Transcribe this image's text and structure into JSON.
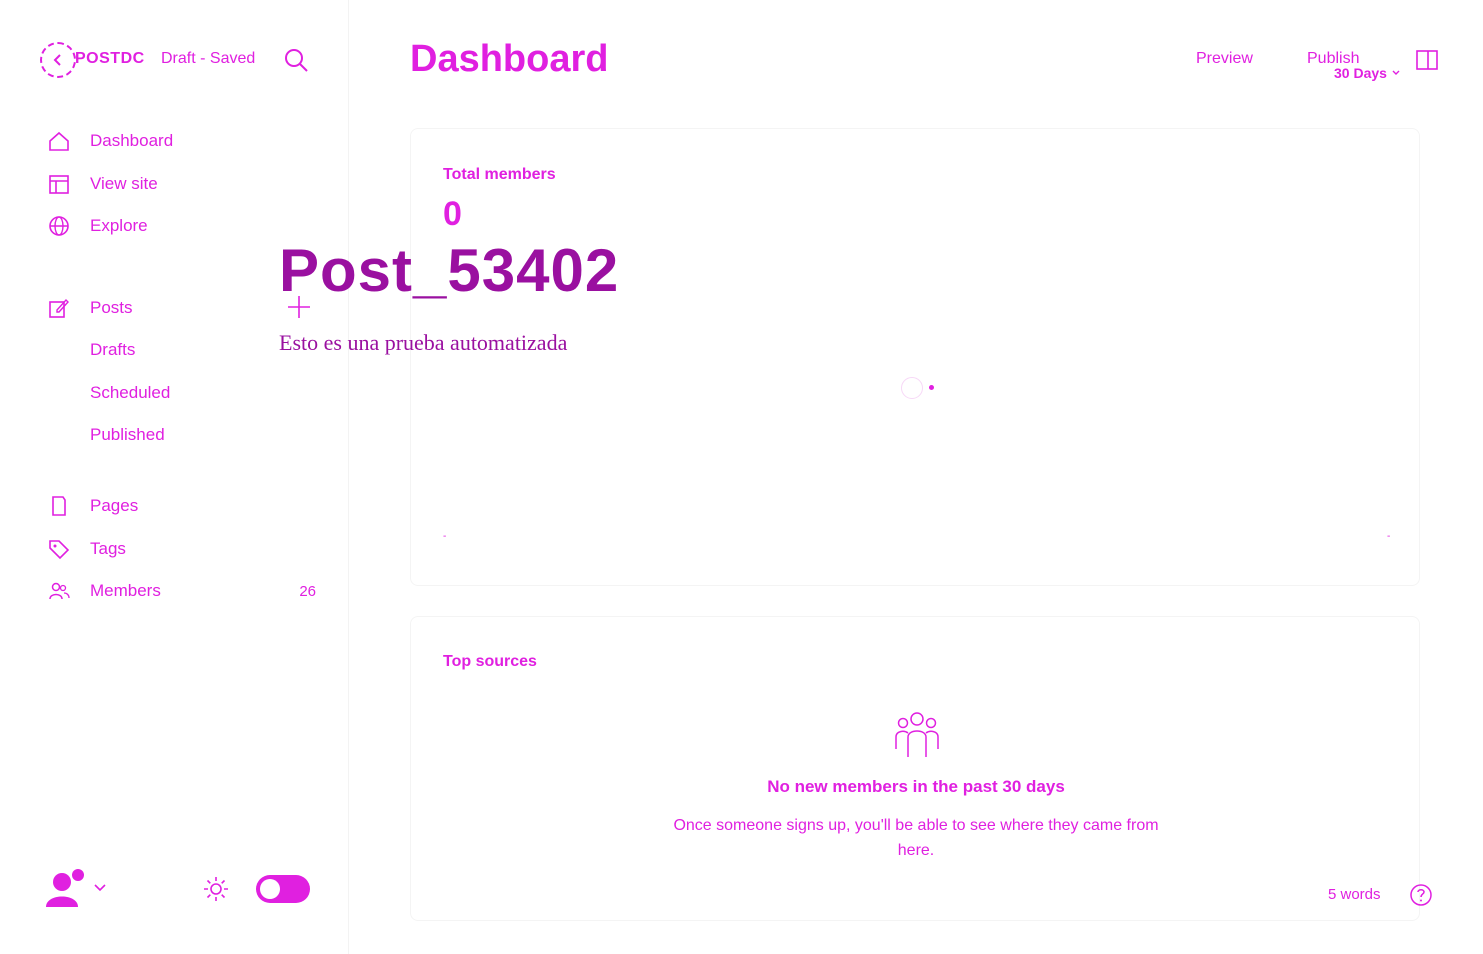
{
  "header": {
    "site_name": "POSTDC",
    "draft_status": "Draft - Saved",
    "page_title": "Dashboard",
    "preview_label": "Preview",
    "publish_label": "Publish",
    "range_label": "30 Days"
  },
  "sidebar": {
    "items": [
      {
        "label": "Dashboard",
        "icon": "home-icon"
      },
      {
        "label": "View site",
        "icon": "layout-icon"
      },
      {
        "label": "Explore",
        "icon": "globe-icon"
      },
      {
        "label": "Posts",
        "icon": "edit-icon"
      },
      {
        "label": "Drafts"
      },
      {
        "label": "Scheduled"
      },
      {
        "label": "Published"
      },
      {
        "label": "Pages",
        "icon": "page-icon"
      },
      {
        "label": "Tags",
        "icon": "tag-icon"
      },
      {
        "label": "Members",
        "icon": "members-icon",
        "count": "26"
      }
    ]
  },
  "members_card": {
    "title": "Total members",
    "value": "0",
    "axis_start": "-",
    "axis_end": "-"
  },
  "sources_card": {
    "title": "Top sources",
    "empty_title": "No new members in the past 30 days",
    "empty_text": "Once someone signs up, you'll be able to see where they came from here."
  },
  "editor": {
    "post_title": "Post_53402",
    "post_body": "Esto es una prueba automatizada",
    "word_count": "5 words"
  },
  "colors": {
    "accent": "#e020e0",
    "editor_text": "#9a10a0"
  }
}
